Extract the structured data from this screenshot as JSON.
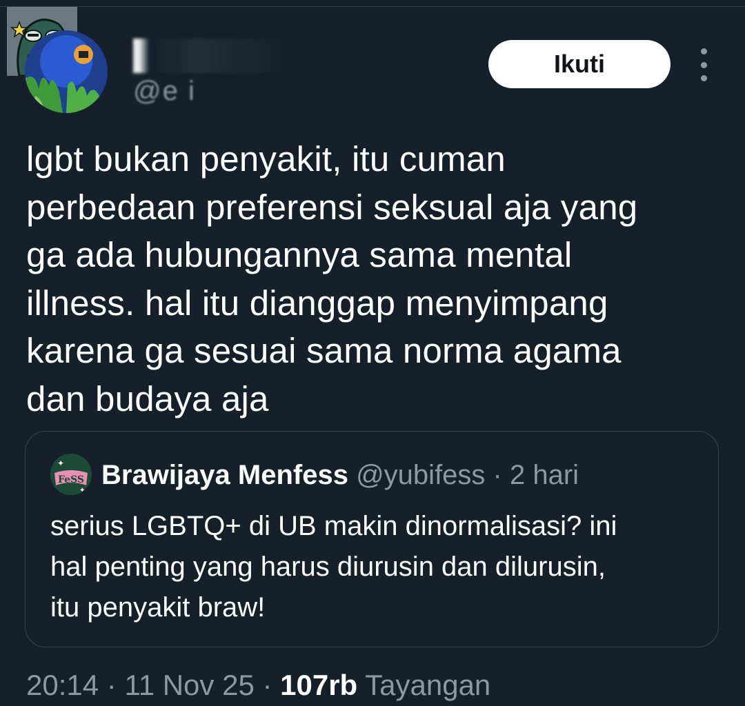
{
  "author": {
    "name": "",
    "handle": "@e        i"
  },
  "actions": {
    "follow_label": "Ikuti",
    "more_icon": "more-vertical-icon"
  },
  "tweet": {
    "text": "lgbt bukan penyakit, itu cuman\nperbedaan preferensi seksual aja yang\nga ada hubungannya sama mental\nillness. hal itu dianggap menyimpang\nkarena ga sesuai sama norma agama\ndan budaya aja"
  },
  "quote": {
    "name": "Brawijaya Menfess",
    "handle": "@yubifess",
    "separator": "·",
    "time": "2 hari",
    "text": "serius LGBTQ+ di UB makin dinormalisasi? ini\nhal penting yang harus diurusin dan dilurusin,\nitu penyakit braw!",
    "avatar_text": "FeSS"
  },
  "footer": {
    "time": "20:14",
    "sep1": "·",
    "date": "11 Nov 25",
    "sep2": "·",
    "views_count": "107rb",
    "views_label": "Tayangan"
  },
  "colors": {
    "background": "#15202b",
    "secondary_text": "#8b98a5",
    "border": "#38444d",
    "follow_bg": "#ffffff"
  }
}
